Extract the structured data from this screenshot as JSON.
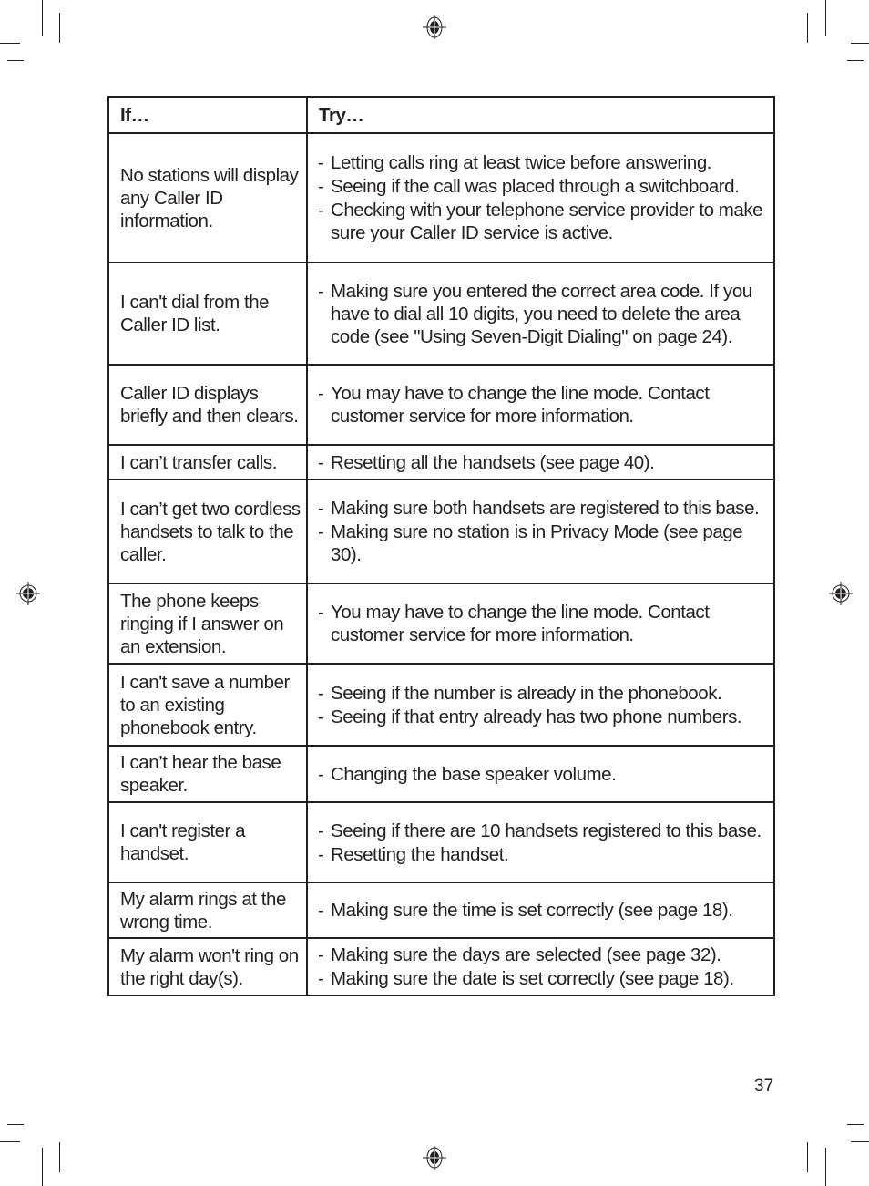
{
  "table": {
    "header": {
      "if": "If…",
      "try": "Try…"
    },
    "rows": [
      {
        "if": "No stations will display any Caller ID information.",
        "try": [
          "Letting calls ring at least twice before answering.",
          "Seeing if the call was placed through a switchboard.",
          "Checking with your telephone service provider to make sure your Caller ID service is active."
        ]
      },
      {
        "if": "I can't dial from the Caller ID list.",
        "try": [
          "Making sure you entered the correct area code. If you have to dial all 10 digits, you need to delete the area code (see \"Using Seven-Digit Dialing\" on page 24)."
        ]
      },
      {
        "if": "Caller ID displays briefly and then clears.",
        "try": [
          "You may have to change the line mode. Contact customer service for more information."
        ]
      },
      {
        "if": "I can’t transfer calls.",
        "try": [
          "Resetting all the handsets (see page 40)."
        ]
      },
      {
        "if": "I can’t get two cordless handsets to talk to the caller.",
        "try": [
          "Making sure both handsets are registered to this base.",
          "Making sure no station is in Privacy Mode (see page 30)."
        ]
      },
      {
        "if": "The phone keeps ringing if I answer on an extension.",
        "try": [
          "You may have to change the line mode. Contact customer service for more information."
        ]
      },
      {
        "if": "I can't save a number to an existing phonebook entry.",
        "try": [
          "Seeing if the number is already in the phonebook.",
          "Seeing if that entry already has two phone numbers."
        ]
      },
      {
        "if": "I can’t hear the base speaker.",
        "try": [
          "Changing the base speaker volume."
        ]
      },
      {
        "if": "I can't register a handset.",
        "try": [
          "Seeing if there are 10 handsets registered to this base.",
          "Resetting the handset."
        ]
      },
      {
        "if": "My alarm rings at the wrong time.",
        "try": [
          "Making sure the time is set correctly (see page 18)."
        ]
      },
      {
        "if": "My alarm won't ring on the right day(s).",
        "try": [
          "Making sure the days are selected (see page 32).",
          "Making sure the date is set correctly (see page 18)."
        ]
      }
    ]
  },
  "bullet_marker": "-",
  "page_number": "37",
  "icons": {
    "registration": "registration-mark-icon",
    "crop": "crop-mark"
  }
}
